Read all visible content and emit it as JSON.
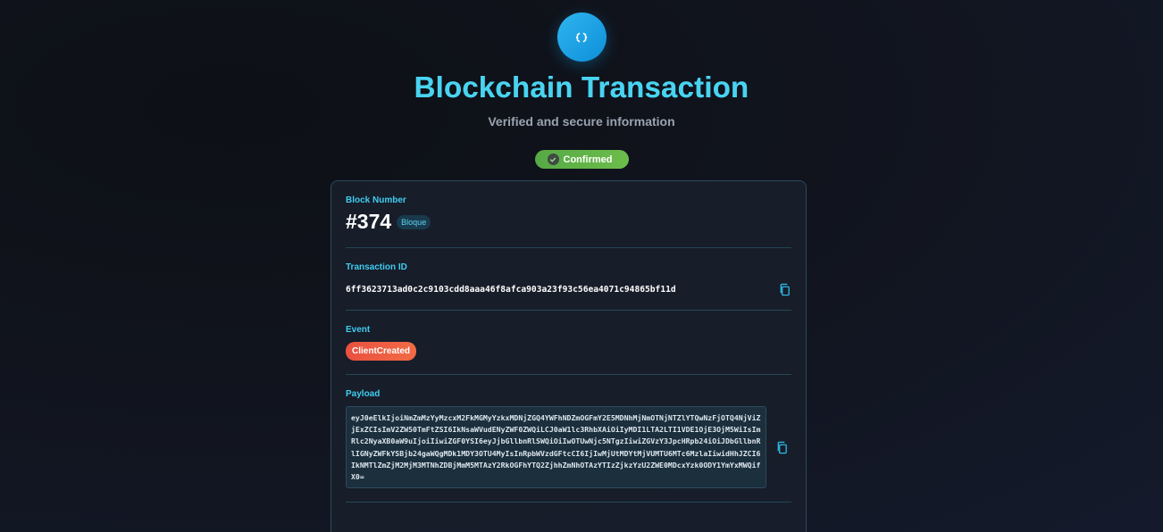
{
  "header": {
    "logo_icon": "code-braces-icon",
    "title": "Blockchain Transaction",
    "subtitle": "Verified and secure information",
    "status": "Confirmed",
    "status_icon": "check-circle-icon"
  },
  "card": {
    "block": {
      "label": "Block Number",
      "value": "#374",
      "tag": "Bloque"
    },
    "transaction": {
      "label": "Transaction ID",
      "value": "6ff3623713ad0c2c9103cdd8aaa46f8afca903a23f93c56ea4071c94865bf11d",
      "copy_icon": "copy-icon"
    },
    "event": {
      "label": "Event",
      "value": "ClientCreated"
    },
    "payload": {
      "label": "Payload",
      "value": "eyJ0eElkIjoiNmZmMzYyMzcxM2FkMGMyYzkxMDNjZGQ4YWFhNDZmOGFmY2E5MDNhMjNmOTNjNTZlYTQwNzFjOTQ4NjViZjExZCIsImV2ZW50TmFtZSI6IkNsaWVudENyZWF0ZWQiLCJ0aW1lc3RhbXAiOiIyMDI1LTA2LTI1VDE1OjE3OjM5WiIsImRlc2NyaXB0aW9uIjoiIiwiZGF0YSI6eyJjbGllbnRlSWQiOiIwOTUwNjc5NTgzIiwiZGVzY3JpcHRpb24iOiJDbGllbnRlIGNyZWFkYSBjb24gaWQgMDk1MDY3OTU4MyIsInRpbWVzdGFtcCI6IjIwMjUtMDYtMjVUMTU6MTc6MzlaIiwidHhJZCI6IkNMTlZmZjM2MjM3MTNhZDBjMmM5MTAzY2RkOGFhYTQ2ZjhhZmNhOTAzYTIzZjkzYzU2ZWE0MDcxYzk0ODY1YmYxMWQifX0=",
      "copy_icon": "copy-icon"
    }
  },
  "colors": {
    "accent": "#3fcdef",
    "success": "#5fb548",
    "event": "#ee5d42"
  }
}
